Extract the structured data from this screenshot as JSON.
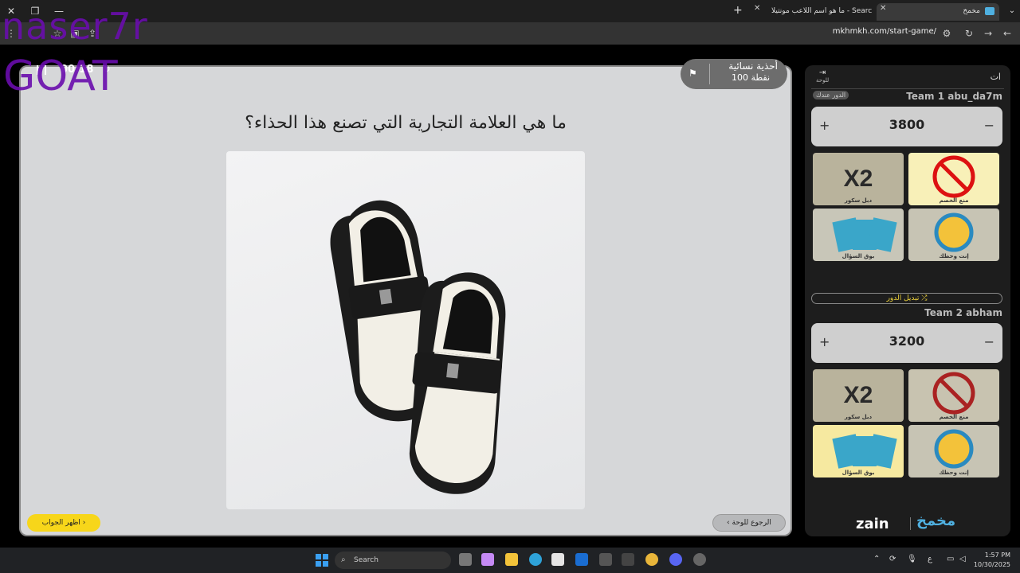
{
  "browser": {
    "tabs": [
      {
        "label": "مخمخ",
        "active": true
      },
      {
        "label": "ما هو اسم اللاعب مونتيلا - Search",
        "active": false
      }
    ],
    "url": "mkhmkh.com/start-game/"
  },
  "watermark": {
    "line1": "naser7r",
    "line2": "GOAT"
  },
  "game": {
    "category": "أحذية نسائية",
    "points": "100 نقطة",
    "timer": "00:18",
    "question": "ما هي العلامة التجارية التي تصنع هذا الحذاء؟",
    "show_answer": "اظهر الجواب",
    "back_to_board": "الرجوع للوحة"
  },
  "panel": {
    "title": "ات",
    "board_label": "للوحة",
    "team1": {
      "name": "Team 1 abu_da7m",
      "turn_badge": "الدور عندك",
      "score": "3800"
    },
    "team2": {
      "name": "Team 2 abham",
      "score": "3200"
    },
    "switch_turn": "تبديل الدور",
    "powers": {
      "double": "دبل سكور",
      "block": "منع الخصم",
      "cards": "بوق السؤال",
      "luck": "إنت وحظك"
    },
    "logo_zain": "zain",
    "logo_mk": "مخمخ"
  },
  "taskbar": {
    "search": "Search",
    "time": "1:57 PM",
    "date": "10/30/2025",
    "lang": "ع"
  }
}
